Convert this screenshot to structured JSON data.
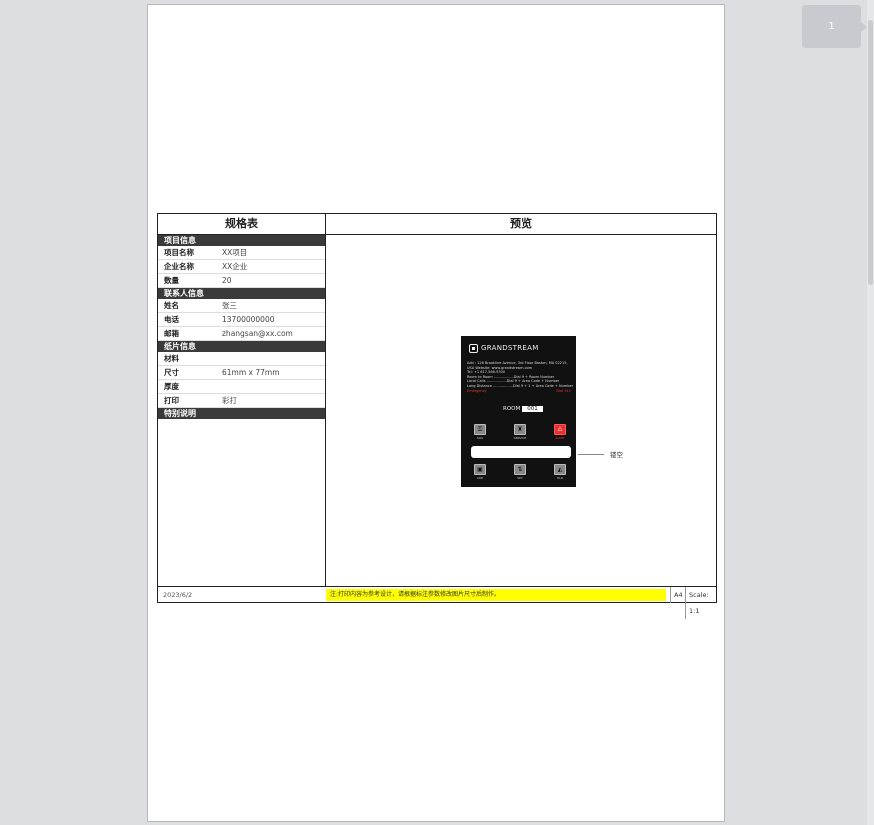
{
  "viewer": {
    "page_number": "1"
  },
  "sheet": {
    "left_title": "规格表",
    "right_title": "预览",
    "sections": [
      {
        "title": "项目信息",
        "rows": [
          {
            "label": "项目名称",
            "value": "XX项目"
          },
          {
            "label": "企业名称",
            "value": "XX企业"
          },
          {
            "label": "数量",
            "value": "20"
          }
        ]
      },
      {
        "title": "联系人信息",
        "rows": [
          {
            "label": "姓名",
            "value": "张三"
          },
          {
            "label": "电话",
            "value": "13700000000"
          },
          {
            "label": "邮箱",
            "value": "zhangsan@xx.com"
          }
        ]
      },
      {
        "title": "纸片信息",
        "rows": [
          {
            "label": "材料",
            "value": ""
          },
          {
            "label": "尺寸",
            "value": "61mm x 77mm"
          },
          {
            "label": "厚度",
            "value": ""
          },
          {
            "label": "打印",
            "value": "彩打"
          }
        ]
      },
      {
        "title": "特别说明",
        "rows": []
      }
    ],
    "footer": {
      "date": "2023/6/2",
      "note": "注:打印内容为参考设计，请根据标注参数修改图片尺寸后制作。",
      "paper": "A4",
      "scale": "Scale: 1:1"
    }
  },
  "card": {
    "brand": "GRANDSTREAM",
    "info_lines": [
      "Add : 126 Brookline Avenue, 3rd Floor Boston, MA 02215,",
      "USA Website: www.grandstream.com",
      "Tel: +1 617-566-9300",
      "Room to Room ..................Dial 9 + Room Number",
      "Local Calls ..................Dial 9 + Area Code + Number",
      "Long Distance ..................Dial 9 + 1 + Area Code + Number"
    ],
    "emergency_left": "Emergency",
    "emergency_right": "Dial 911",
    "room_label": "ROOM",
    "room_number": "001",
    "top_buttons": [
      {
        "glyph": "⚿",
        "label": "SOS"
      },
      {
        "glyph": "♜",
        "label": "SERVICE"
      },
      {
        "glyph": "⚠",
        "label": "ALERT",
        "accent": true
      }
    ],
    "bottom_buttons": [
      {
        "glyph": "▣",
        "label": "CDE"
      },
      {
        "glyph": "⇅",
        "label": "SET"
      },
      {
        "glyph": "◭",
        "label": "HLD"
      }
    ],
    "cutout_label": "镂空"
  }
}
